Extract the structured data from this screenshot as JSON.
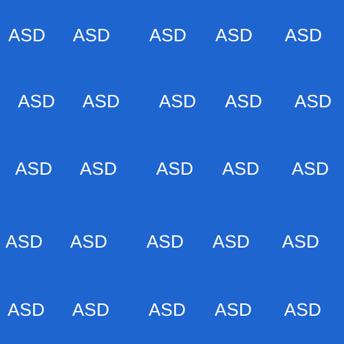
{
  "background_color": "#1f65cf",
  "text_color": "#ffffff",
  "rows": [
    [
      "ASD",
      "ASD",
      "ASD",
      "ASD",
      "ASD"
    ],
    [
      "ASD",
      "ASD",
      "ASD",
      "ASD",
      "ASD"
    ],
    [
      "ASD",
      "ASD",
      "ASD",
      "ASD",
      "ASD"
    ],
    [
      "ASD",
      "ASD",
      "ASD",
      "ASD",
      "ASD"
    ],
    [
      "ASD",
      "ASD",
      "ASD",
      "ASD",
      "ASD"
    ]
  ]
}
